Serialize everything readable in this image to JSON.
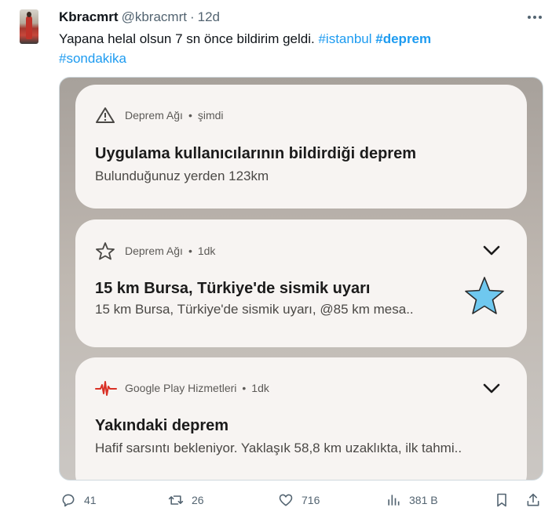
{
  "tweet": {
    "name": "Kbracmrt",
    "handle": "@kbracmrt",
    "separator": "·",
    "time": "12d",
    "text_main": "Yapana helal olsun 7 sn önce bildirim geldi.",
    "hashtag_1": "#istanbul",
    "hashtag_2": "#deprem",
    "hashtag_3": "#sondakika"
  },
  "notifications": [
    {
      "app": "Deprem Ağı",
      "dot": "•",
      "time": "şimdi",
      "title": "Uygulama kullanıcılarının bildirdiği deprem",
      "body": "Bulunduğunuz yerden 123km",
      "icon": "warning-triangle-icon"
    },
    {
      "app": "Deprem Ağı",
      "dot": "•",
      "time": "1dk",
      "title": "15 km Bursa, Türkiye'de sismik uyarı",
      "body": "15 km Bursa, Türkiye'de sismik uyarı, @85 km mesa..",
      "icon": "star-outline-icon"
    },
    {
      "app": "Google Play Hizmetleri",
      "dot": "•",
      "time": "1dk",
      "title": "Yakındaki deprem",
      "body": "Hafif sarsıntı bekleniyor. Yaklaşık 58,8 km uzaklıkta, ilk tahmi..",
      "icon": "seismograph-icon"
    }
  ],
  "actions": {
    "replies": "41",
    "reposts": "26",
    "likes": "716",
    "views": "381 B"
  },
  "colors": {
    "accent": "#1d9bf0",
    "muted": "#536471",
    "star_fill": "#6fc8ef",
    "seismo_red": "#d93025"
  }
}
